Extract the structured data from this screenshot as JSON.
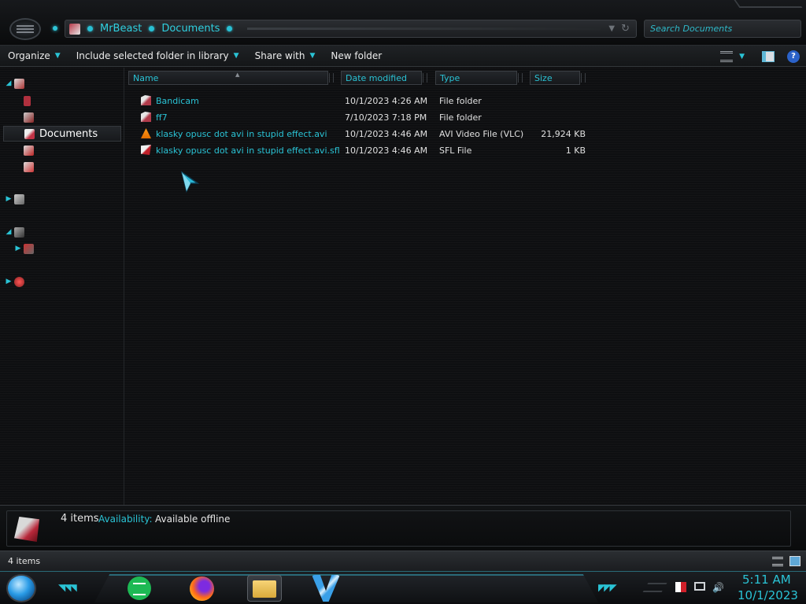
{
  "address": {
    "crumbs": [
      "MrBeast",
      "Documents"
    ]
  },
  "search": {
    "placeholder": "Search Documents"
  },
  "toolbar": {
    "organize": "Organize",
    "include": "Include selected folder in library",
    "share": "Share with",
    "new_folder": "New folder"
  },
  "navpane": {
    "selected": "Documents"
  },
  "columns": {
    "name": "Name",
    "date": "Date modified",
    "type": "Type",
    "size": "Size"
  },
  "files": [
    {
      "name": "Bandicam",
      "date": "10/1/2023 4:26 AM",
      "type": "File folder",
      "size": "",
      "icon": "folder-icon"
    },
    {
      "name": "ff7",
      "date": "7/10/2023 7:18 PM",
      "type": "File folder",
      "size": "",
      "icon": "folder-icon"
    },
    {
      "name": "klasky opusc dot avi in stupid effect.avi",
      "date": "10/1/2023 4:46 AM",
      "type": "AVI Video File (VLC)",
      "size": "21,924 KB",
      "icon": "vlc-icon"
    },
    {
      "name": "klasky opusc dot avi in stupid effect.avi.sfl",
      "date": "10/1/2023 4:46 AM",
      "type": "SFL File",
      "size": "1 KB",
      "icon": "sfl-file-icon"
    }
  ],
  "details": {
    "count": "4 items",
    "availability_label": "Availability:",
    "availability_value": "Available offline"
  },
  "status": {
    "count": "4 items"
  },
  "clock": {
    "time": "5:11 AM",
    "date": "10/1/2023"
  },
  "colors": {
    "accent": "#2ac3d5",
    "background": "#0e0f11"
  }
}
